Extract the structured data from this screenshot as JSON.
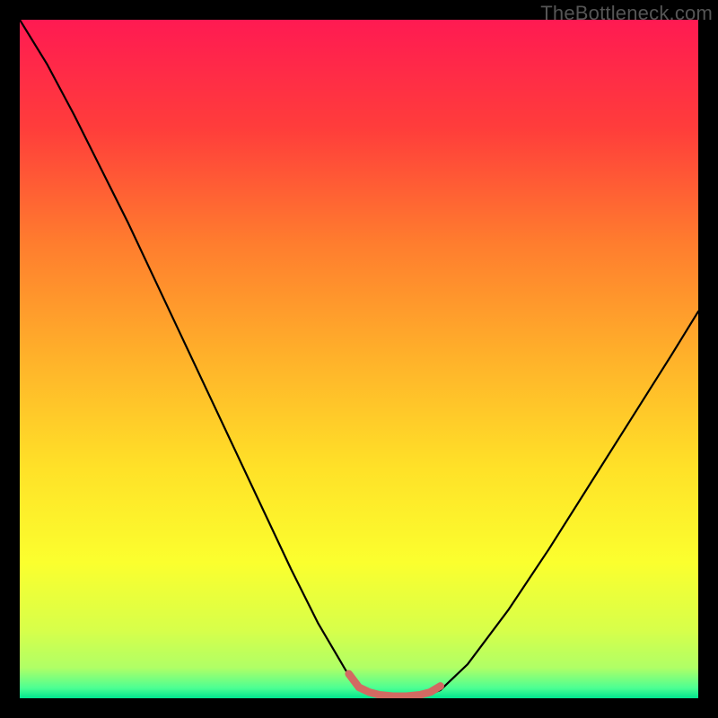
{
  "watermark": "TheBottleneck.com",
  "chart_data": {
    "type": "line",
    "title": "",
    "xlabel": "",
    "ylabel": "",
    "xlim": [
      0,
      100
    ],
    "ylim": [
      0,
      100
    ],
    "grid": false,
    "legend": false,
    "gradient_stops": [
      {
        "offset": 0,
        "color": "#ff1a52"
      },
      {
        "offset": 0.16,
        "color": "#ff3d3b"
      },
      {
        "offset": 0.33,
        "color": "#ff7d2e"
      },
      {
        "offset": 0.5,
        "color": "#ffb22a"
      },
      {
        "offset": 0.66,
        "color": "#ffe128"
      },
      {
        "offset": 0.8,
        "color": "#fbff2e"
      },
      {
        "offset": 0.9,
        "color": "#d7ff4a"
      },
      {
        "offset": 0.955,
        "color": "#b0ff66"
      },
      {
        "offset": 0.985,
        "color": "#4cff93"
      },
      {
        "offset": 1.0,
        "color": "#00e58f"
      }
    ],
    "series": [
      {
        "name": "bottleneck-curve",
        "stroke": "#000000",
        "stroke_width": 2.2,
        "x": [
          0,
          4,
          8,
          12,
          16,
          20,
          24,
          28,
          32,
          36,
          40,
          44,
          48,
          50,
          53,
          56,
          59,
          62,
          66,
          72,
          78,
          84,
          90,
          96,
          100
        ],
        "y": [
          100,
          93.5,
          86,
          78,
          70,
          61.5,
          53,
          44.5,
          36,
          27.5,
          19,
          11,
          4.2,
          1.2,
          0.1,
          0.1,
          0.1,
          1.2,
          5,
          13,
          22,
          31.5,
          41,
          50.5,
          57
        ]
      },
      {
        "name": "sweet-spot-band",
        "stroke": "#d26a62",
        "stroke_width": 8.5,
        "x": [
          48.5,
          50,
          51.5,
          53,
          55,
          57,
          59,
          60.5,
          62
        ],
        "y": [
          3.6,
          1.6,
          0.9,
          0.5,
          0.3,
          0.3,
          0.5,
          0.9,
          1.8
        ]
      }
    ]
  }
}
